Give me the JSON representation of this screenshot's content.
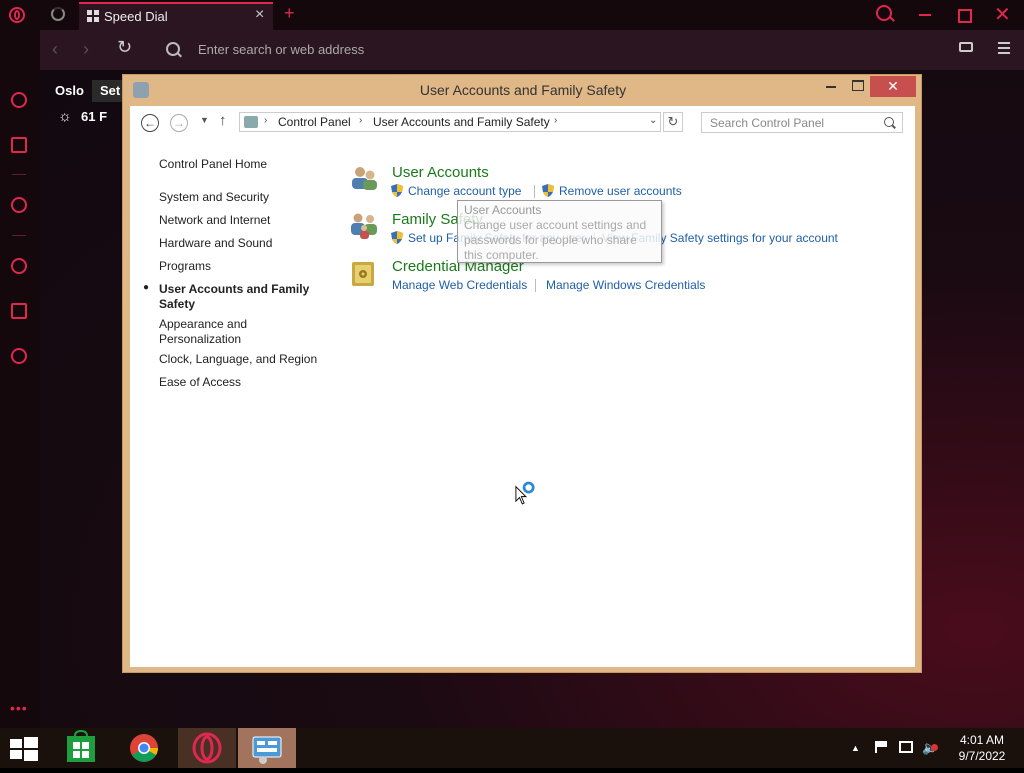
{
  "browser": {
    "tab_title": "Speed Dial",
    "address_placeholder": "Enter search or web address"
  },
  "speed_dial": {
    "city": "Oslo",
    "settings_button": "Set",
    "temperature": "61 F"
  },
  "window": {
    "title": "User Accounts and Family Safety",
    "breadcrumb": [
      "Control Panel",
      "User Accounts and Family Safety"
    ],
    "search_placeholder": "Search Control Panel"
  },
  "left_nav": {
    "home": "Control Panel Home",
    "items": [
      "System and Security",
      "Network and Internet",
      "Hardware and Sound",
      "Programs",
      "User Accounts and Family Safety",
      "Appearance and Personalization",
      "Clock, Language, and Region",
      "Ease of Access"
    ],
    "current_index": 4
  },
  "categories": [
    {
      "title": "User Accounts",
      "links": [
        "Change account type",
        "Remove user accounts"
      ]
    },
    {
      "title": "Family Safety",
      "links": [
        "Set up Family Safety for any user",
        "View Family Safety settings for your account"
      ]
    },
    {
      "title": "Credential Manager",
      "links": [
        "Manage Web Credentials",
        "Manage Windows Credentials"
      ]
    }
  ],
  "tooltip": {
    "title": "User Accounts",
    "body": "Change user account settings and passwords for people who share this computer."
  },
  "taskbar": {
    "time": "4:01 AM",
    "date": "9/7/2022"
  },
  "colors": {
    "opera_accent": "#e0284f",
    "category_title": "#1a7a1a",
    "link": "#1f5fa8",
    "window_frame": "#e0b786"
  }
}
